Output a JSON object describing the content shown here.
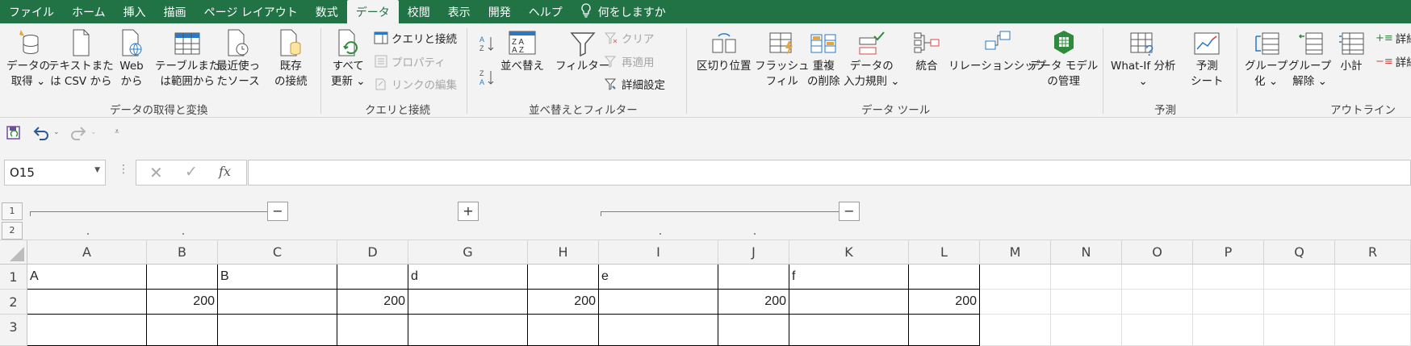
{
  "tabs": [
    "ファイル",
    "ホーム",
    "挿入",
    "描画",
    "ページ レイアウト",
    "数式",
    "データ",
    "校閲",
    "表示",
    "開発",
    "ヘルプ"
  ],
  "tell_me": "何をしますか",
  "ribbon": {
    "get_data": "データの取得 ⌄",
    "get_data_l1": "データの",
    "get_data_l2": "取得 ⌄",
    "from_text_l1": "テキストまた",
    "from_text_l2": "は CSV から",
    "from_web_l1": "Web",
    "from_web_l2": "から",
    "from_table_l1": "テーブルまた",
    "from_table_l2": "は範囲から",
    "recent_l1": "最近使っ",
    "recent_l2": "たソース",
    "existing_l1": "既存",
    "existing_l2": "の接続",
    "group1": "データの取得と変換",
    "refresh_l1": "すべて",
    "refresh_l2": "更新 ⌄",
    "queries": "クエリと接続",
    "properties": "プロパティ",
    "edit_links": "リンクの編集",
    "group2": "クエリと接続",
    "sort": "並べ替え",
    "filter": "フィルター",
    "clear": "クリア",
    "reapply": "再適用",
    "advanced": "詳細設定",
    "group3": "並べ替えとフィルター",
    "text_to_cols": "区切り位置",
    "flash_l1": "フラッシュ",
    "flash_l2": "フィル",
    "dup_l1": "重複",
    "dup_l2": "の削除",
    "valid_l1": "データの",
    "valid_l2": "入力規則 ⌄",
    "consolidate": "統合",
    "relations": "リレーションシップ",
    "model_l1": "データ モデル",
    "model_l2": "の管理",
    "group4": "データ ツール",
    "whatif": "What-If 分析",
    "whatif_l2": "⌄",
    "forecast_l1": "予測",
    "forecast_l2": "シート",
    "group5": "予測",
    "group_l1": "グループ",
    "group_l2": "化 ⌄",
    "ungroup_l1": "グループ",
    "ungroup_l2": "解除 ⌄",
    "subtotal": "小計",
    "detail1": "詳細",
    "detail2": "詳細",
    "group6": "アウトライン"
  },
  "namebox": "O15",
  "fx": "fx",
  "outline": {
    "level1": "1",
    "level2": "2",
    "minus": "−",
    "plus": "+"
  },
  "columns": [
    "A",
    "B",
    "C",
    "D",
    "G",
    "H",
    "I",
    "J",
    "K",
    "L",
    "M",
    "N",
    "O",
    "P",
    "Q",
    "R"
  ],
  "rows": [
    "1",
    "2",
    "3"
  ],
  "cells": {
    "A1": "A",
    "C1": "B",
    "G1": "d",
    "I1": "e",
    "K1": "f",
    "B2": "200",
    "D2": "200",
    "H2": "200",
    "J2": "200",
    "L2": "200"
  },
  "colors": {
    "accent": "#217346",
    "ribbon_bg": "#f3f3f3"
  }
}
